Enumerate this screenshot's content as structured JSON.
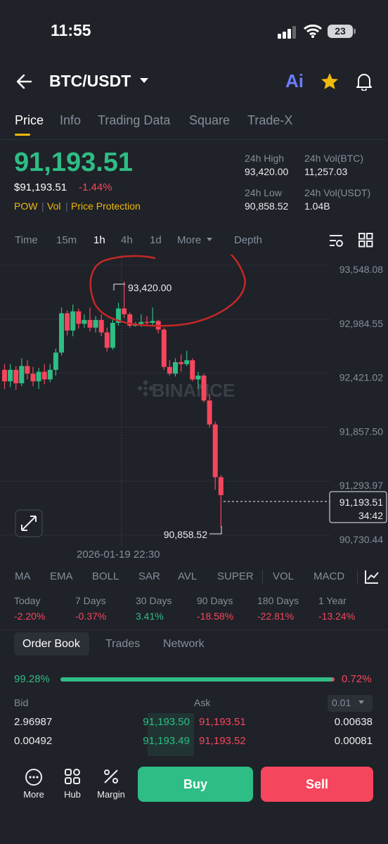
{
  "status_bar": {
    "time": "11:55",
    "battery": "23"
  },
  "header": {
    "pair": "BTC/USDT",
    "ai_label": "Ai"
  },
  "tabs": [
    "Price",
    "Info",
    "Trading Data",
    "Square",
    "Trade-X"
  ],
  "price": {
    "last": "91,193.51",
    "usd": "$91,193.51",
    "change_pct": "-1.44%",
    "tags": [
      "POW",
      "Vol",
      "Price Protection"
    ]
  },
  "stats": {
    "high_label": "24h High",
    "high": "93,420.00",
    "vol_btc_label": "24h Vol(BTC)",
    "vol_btc": "11,257.03",
    "low_label": "24h Low",
    "low": "90,858.52",
    "vol_usdt_label": "24h Vol(USDT)",
    "vol_usdt": "1.04B"
  },
  "timeframes": [
    "Time",
    "15m",
    "1h",
    "4h",
    "1d",
    "More",
    "Depth"
  ],
  "chart_data": {
    "type": "candlestick",
    "y_ticks": [
      "93,548.08",
      "92,984.55",
      "92,421.02",
      "91,857.50",
      "91,293.97",
      "90,730.44"
    ],
    "ylim": [
      90730.44,
      93548.08
    ],
    "high_marker": "93,420.00",
    "low_marker": "90,858.52",
    "current_price": "91,193.51",
    "countdown": "34:42",
    "crosshair_time": "2026-01-19 22:30",
    "watermark": "BINANCE",
    "candles": [
      {
        "o": 92500,
        "c": 92380,
        "h": 92560,
        "l": 92300
      },
      {
        "o": 92380,
        "c": 92500,
        "h": 92560,
        "l": 92320
      },
      {
        "o": 92500,
        "c": 92360,
        "h": 92540,
        "l": 92290
      },
      {
        "o": 92360,
        "c": 92540,
        "h": 92620,
        "l": 92330
      },
      {
        "o": 92540,
        "c": 92460,
        "h": 92600,
        "l": 92400
      },
      {
        "o": 92460,
        "c": 92380,
        "h": 92530,
        "l": 92330
      },
      {
        "o": 92380,
        "c": 92480,
        "h": 92520,
        "l": 92300
      },
      {
        "o": 92480,
        "c": 92400,
        "h": 92560,
        "l": 92350
      },
      {
        "o": 92400,
        "c": 92500,
        "h": 92560,
        "l": 92370
      },
      {
        "o": 92500,
        "c": 92680,
        "h": 92720,
        "l": 92440
      },
      {
        "o": 92680,
        "c": 93090,
        "h": 93150,
        "l": 92650
      },
      {
        "o": 93090,
        "c": 92910,
        "h": 93120,
        "l": 92860
      },
      {
        "o": 92910,
        "c": 93110,
        "h": 93180,
        "l": 92850
      },
      {
        "o": 93110,
        "c": 92980,
        "h": 93140,
        "l": 92930
      },
      {
        "o": 92980,
        "c": 93020,
        "h": 93080,
        "l": 92940
      },
      {
        "o": 93020,
        "c": 92940,
        "h": 93150,
        "l": 92900
      },
      {
        "o": 92940,
        "c": 93020,
        "h": 93060,
        "l": 92890
      },
      {
        "o": 93020,
        "c": 92890,
        "h": 93080,
        "l": 92850
      },
      {
        "o": 92890,
        "c": 92730,
        "h": 92940,
        "l": 92690
      },
      {
        "o": 92730,
        "c": 92990,
        "h": 93040,
        "l": 92710
      },
      {
        "o": 92990,
        "c": 93140,
        "h": 93200,
        "l": 92960
      },
      {
        "o": 93140,
        "c": 93080,
        "h": 93420,
        "l": 93040
      },
      {
        "o": 93080,
        "c": 92960,
        "h": 93100,
        "l": 92940
      },
      {
        "o": 92960,
        "c": 92980,
        "h": 93000,
        "l": 92950
      },
      {
        "o": 92980,
        "c": 93000,
        "h": 93080,
        "l": 92950
      },
      {
        "o": 93000,
        "c": 92990,
        "h": 93060,
        "l": 92960
      },
      {
        "o": 92990,
        "c": 93010,
        "h": 93150,
        "l": 92960
      },
      {
        "o": 93010,
        "c": 92920,
        "h": 93020,
        "l": 92880
      },
      {
        "o": 92920,
        "c": 92530,
        "h": 92940,
        "l": 92500
      },
      {
        "o": 92530,
        "c": 92460,
        "h": 92600,
        "l": 92440
      },
      {
        "o": 92460,
        "c": 92580,
        "h": 92620,
        "l": 92430
      },
      {
        "o": 92580,
        "c": 92560,
        "h": 92660,
        "l": 92480
      },
      {
        "o": 92560,
        "c": 92600,
        "h": 92700,
        "l": 92540
      },
      {
        "o": 92600,
        "c": 92400,
        "h": 92620,
        "l": 92380
      },
      {
        "o": 92400,
        "c": 92440,
        "h": 92480,
        "l": 92300
      },
      {
        "o": 92440,
        "c": 92180,
        "h": 92460,
        "l": 92160
      },
      {
        "o": 92180,
        "c": 91930,
        "h": 92250,
        "l": 91900
      },
      {
        "o": 91930,
        "c": 91380,
        "h": 91960,
        "l": 91250
      },
      {
        "o": 91380,
        "c": 91193.51,
        "h": 91400,
        "l": 90858.52
      }
    ]
  },
  "indicators": [
    "MA",
    "EMA",
    "BOLL",
    "SAR",
    "AVL",
    "SUPER",
    "VOL",
    "MACD"
  ],
  "performance": [
    {
      "label": "Today",
      "value": "-2.20%",
      "dir": "down"
    },
    {
      "label": "7 Days",
      "value": "-0.37%",
      "dir": "down"
    },
    {
      "label": "30 Days",
      "value": "3.41%",
      "dir": "up"
    },
    {
      "label": "90 Days",
      "value": "-18.58%",
      "dir": "down"
    },
    {
      "label": "180 Days",
      "value": "-22.81%",
      "dir": "down"
    },
    {
      "label": "1 Year",
      "value": "-13.24%",
      "dir": "down"
    }
  ],
  "orderbook": {
    "tabs": [
      "Order Book",
      "Trades",
      "Network"
    ],
    "bid_pct": "99.28%",
    "ask_pct": "0.72%",
    "bid_ratio": 0.9928,
    "bid_header": "Bid",
    "ask_header": "Ask",
    "precision": "0.01",
    "rows": [
      {
        "bid_qty": "2.96987",
        "bid_price": "91,193.50",
        "ask_price": "91,193.51",
        "ask_qty": "0.00638"
      },
      {
        "bid_qty": "0.00492",
        "bid_price": "91,193.49",
        "ask_price": "91,193.52",
        "ask_qty": "0.00081"
      }
    ]
  },
  "bottom": {
    "more": "More",
    "hub": "Hub",
    "margin": "Margin",
    "buy": "Buy",
    "sell": "Sell"
  },
  "colors": {
    "up": "#2ebd85",
    "down": "#f6465d",
    "accent": "#f0b90b",
    "annotation": "#c62828"
  }
}
